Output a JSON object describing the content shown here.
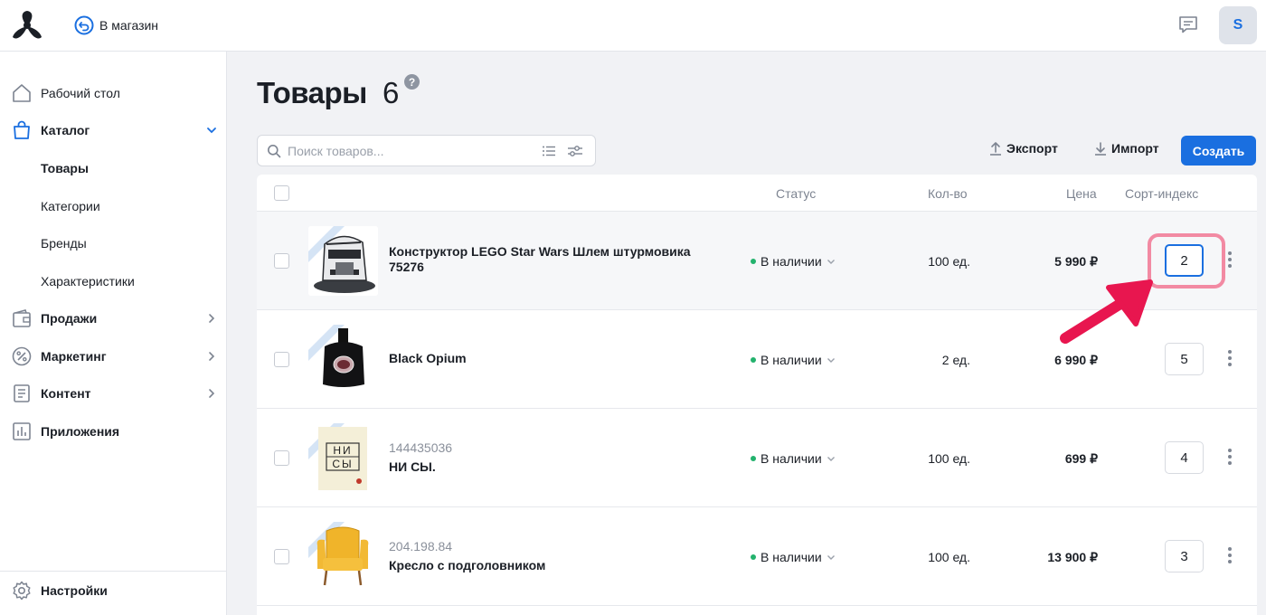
{
  "header": {
    "store_link_label": "В магазин",
    "avatar_initial": "S"
  },
  "sidebar": {
    "items": [
      {
        "label": "Рабочий стол"
      },
      {
        "label": "Каталог"
      },
      {
        "label": "Продажи"
      },
      {
        "label": "Маркетинг"
      },
      {
        "label": "Контент"
      },
      {
        "label": "Приложения"
      }
    ],
    "catalog_sub": [
      {
        "label": "Товары"
      },
      {
        "label": "Категории"
      },
      {
        "label": "Бренды"
      },
      {
        "label": "Характеристики"
      }
    ],
    "settings_label": "Настройки"
  },
  "main": {
    "title": "Товары",
    "count": "6",
    "help": "?",
    "search_placeholder": "Поиск товаров...",
    "export_label": "Экспорт",
    "import_label": "Импорт",
    "create_label": "Создать"
  },
  "table": {
    "columns": {
      "status": "Статус",
      "qty": "Кол-во",
      "price": "Цена",
      "sort": "Сорт-индекс"
    },
    "rows": [
      {
        "sku": "",
        "name_line1": "Конструктор LEGO Star Wars Шлем штурмовика",
        "name_line2": "75276",
        "status": "В наличии",
        "qty": "100 ед.",
        "price": "5 990 ₽",
        "sort": "2"
      },
      {
        "sku": "",
        "name_line1": "Black Opium",
        "name_line2": "",
        "status": "В наличии",
        "qty": "2 ед.",
        "price": "6 990 ₽",
        "sort": "5"
      },
      {
        "sku": "144435036",
        "name_line1": "НИ СЫ.",
        "name_line2": "",
        "status": "В наличии",
        "qty": "100 ед.",
        "price": "699 ₽",
        "sort": "4"
      },
      {
        "sku": "204.198.84",
        "name_line1": "Кресло с подголовником",
        "name_line2": "",
        "status": "В наличии",
        "qty": "100 ед.",
        "price": "13 900 ₽",
        "sort": "3"
      }
    ]
  },
  "book_cover_text": {
    "line1": "НИ",
    "line2": "СЫ"
  },
  "colors": {
    "accent": "#1a6fe0",
    "status_dot": "#23b26d",
    "highlight": "#f28aa3",
    "arrow": "#e8164f"
  }
}
